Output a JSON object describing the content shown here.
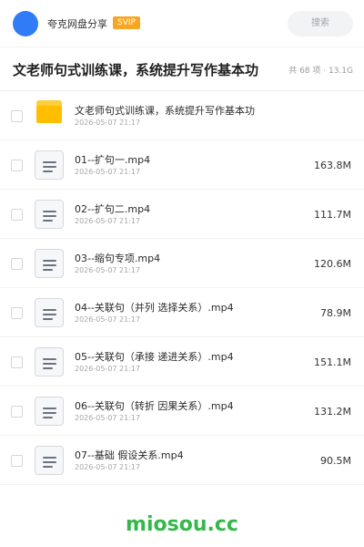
{
  "header": {
    "username": "夸克网盘分享",
    "badge": "SVIP",
    "search_placeholder": "搜索"
  },
  "folder": {
    "title": "文老师句式训练课，系统提升写作基本功",
    "meta": "共 68 项 · 13.1G"
  },
  "items": [
    {
      "type": "folder",
      "name": "文老师句式训练课，系统提升写作基本功",
      "date": "2026-05-07 21:17",
      "size": ""
    },
    {
      "type": "file",
      "name": "01--扩句一.mp4",
      "date": "2026-05-07 21:17",
      "size": "163.8M"
    },
    {
      "type": "file",
      "name": "02--扩句二.mp4",
      "date": "2026-05-07 21:17",
      "size": "111.7M"
    },
    {
      "type": "file",
      "name": "03--缩句专项.mp4",
      "date": "2026-05-07 21:17",
      "size": "120.6M"
    },
    {
      "type": "file",
      "name": "04--关联句（并列 选择关系）.mp4",
      "date": "2026-05-07 21:17",
      "size": "78.9M"
    },
    {
      "type": "file",
      "name": "05--关联句（承接 递进关系）.mp4",
      "date": "2026-05-07 21:17",
      "size": "151.1M"
    },
    {
      "type": "file",
      "name": "06--关联句（转折 因果关系）.mp4",
      "date": "2026-05-07 21:17",
      "size": "131.2M"
    },
    {
      "type": "file",
      "name": "07--基础 假设关系.mp4",
      "date": "2026-05-07 21:17",
      "size": "90.5M"
    }
  ],
  "icons": {
    "folder": "folder-icon",
    "file": "document-icon",
    "checkbox": "checkbox-icon"
  },
  "colors": {
    "avatar": "#2f7cf6",
    "svip": "#f5a623",
    "folder": "#ffbf00",
    "watermark": "#35b84a"
  },
  "watermark": "miosou.cc"
}
